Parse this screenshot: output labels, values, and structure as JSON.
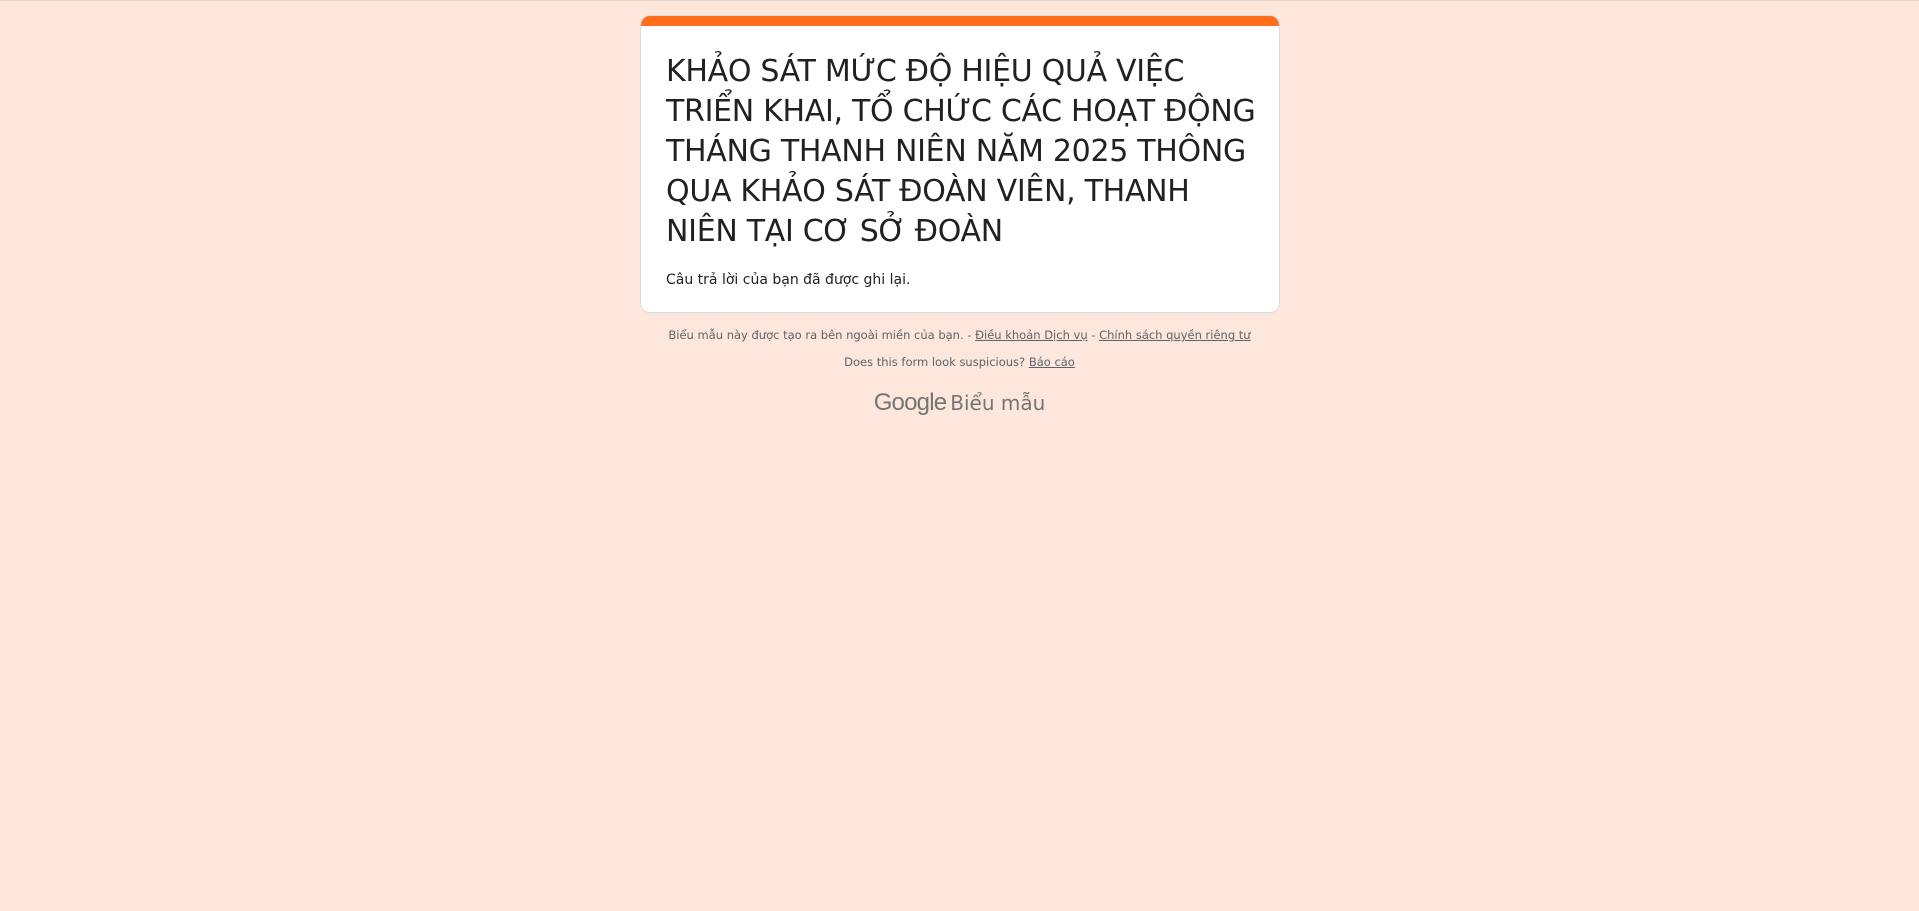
{
  "form": {
    "title": "KHẢO SÁT MỨC ĐỘ HIỆU QUẢ VIỆC TRIỂN KHAI, TỔ CHỨC CÁC HOẠT ĐỘNG THÁNG THANH NIÊN NĂM 2025 THÔNG QUA KHẢO SÁT ĐOÀN VIÊN, THANH NIÊN TẠI CƠ SỞ ĐOÀN",
    "confirmation_message": "Câu trả lời của bạn đã được ghi lại.",
    "accent_color": "#ff6d1b"
  },
  "footer": {
    "disclaimer": "Biểu mẫu này được tạo ra bên ngoài miền của bạn. -",
    "separator": "-",
    "terms_link": "Điều khoản Dịch vụ",
    "privacy_link": "Chính sách quyền riêng tư",
    "suspicious_question": "Does this form look suspicious?",
    "report_link": "Báo cáo"
  },
  "brand": {
    "google": "Google",
    "product": "Biểu mẫu"
  },
  "colors": {
    "page_background": "#fde7dc",
    "card_background": "#ffffff",
    "text": "#202124",
    "footer_text": "#5f6368"
  }
}
